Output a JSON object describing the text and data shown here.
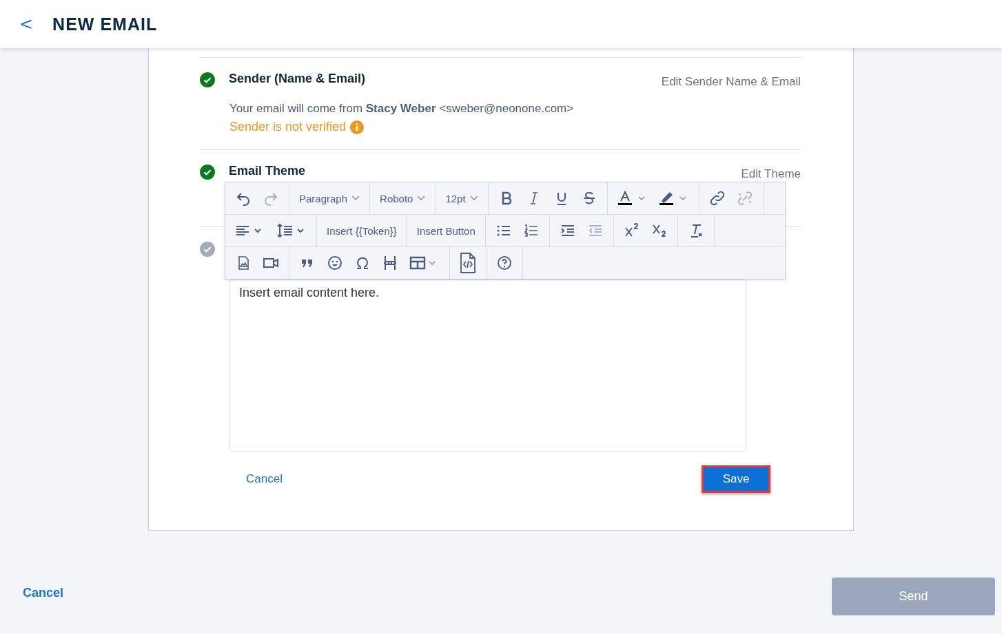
{
  "header": {
    "back": "<",
    "title": "NEW EMAIL"
  },
  "sections": [
    {
      "completed": true,
      "title": "Sender (Name & Email)",
      "action": "Edit Sender Name & Email",
      "body": "Your email will come from **Stacy Weber** <sweber@neonone.com>",
      "warning": "Sender is not verified"
    },
    {
      "completed": true,
      "title": "Email Theme",
      "action": "Edit Theme"
    },
    {
      "completed": false
    }
  ],
  "toolbar": {
    "dropdowns": [
      {
        "label": "Paragraph"
      },
      {
        "label": "Roboto"
      },
      {
        "label": "12pt"
      }
    ],
    "buttons": [
      {
        "label": "Insert {{Token}}"
      },
      {
        "label": "Insert Button"
      }
    ],
    "redo_disabled": true,
    "unlink_disabled": true,
    "outdent_disabled": true
  },
  "editor": {
    "value": "Insert email content here."
  },
  "form_actions": {
    "cancel": "Cancel",
    "save": "Save"
  },
  "footer": {
    "cancel": "Cancel",
    "send": {
      "label": "Send",
      "disabled": true
    }
  }
}
